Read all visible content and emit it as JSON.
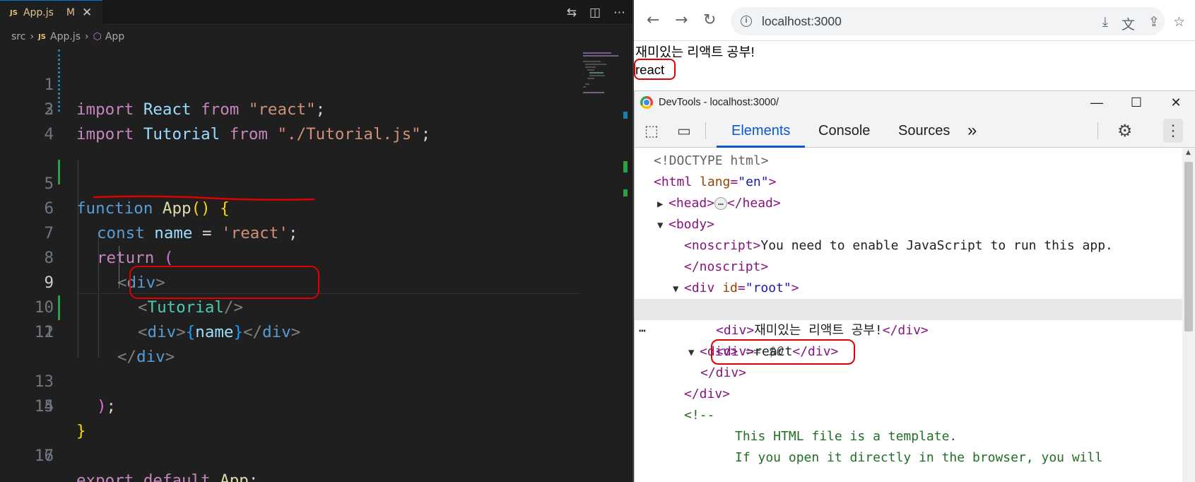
{
  "vscode": {
    "tab": {
      "file": "App.js",
      "lang_badge": "JS",
      "status": "M",
      "close": "✕"
    },
    "breadcrumb": {
      "folder": "src",
      "file": "App.js",
      "symbol": "App",
      "lang_badge": "JS"
    },
    "line_numbers": [
      "1",
      "2",
      "3",
      "4",
      "5",
      "6",
      "7",
      "8",
      "9",
      "10",
      "11",
      "12",
      "13",
      "14",
      "15",
      "16",
      "17"
    ],
    "code": {
      "l1": {
        "kw": "import",
        "name": "React",
        "from": "from",
        "src": "\"react\"",
        "end": ";"
      },
      "l2": {
        "kw": "import",
        "name": "Tutorial",
        "from": "from",
        "src": "\"./Tutorial.js\"",
        "end": ";"
      },
      "l5": {
        "kw": "function",
        "name": "App",
        "parens": "()",
        "brace": "{"
      },
      "l6": {
        "kw": "const",
        "name": "name",
        "eq": "=",
        "val": "'react'",
        "end": ";"
      },
      "l7": {
        "kw": "return",
        "paren": "("
      },
      "l8": {
        "open": "<",
        "tag": "div",
        "close": ">"
      },
      "l9": {
        "open": "<",
        "tag": "Tutorial",
        "close": "/>"
      },
      "l10": {
        "open": "<",
        "tag": "div",
        "close": ">",
        "b1": "{",
        "expr": "name",
        "b2": "}",
        "open2": "</",
        "tag2": "div",
        "close2": ">"
      },
      "l11": {
        "open": "</",
        "tag": "div",
        "close": ">"
      },
      "l13": {
        "paren": ")",
        "end": ";"
      },
      "l14": {
        "brace": "}"
      },
      "l16": {
        "kw1": "export",
        "kw2": "default",
        "name": "App",
        "end": ";"
      }
    }
  },
  "browser": {
    "url": "localhost:3000",
    "page_lines": [
      "재미있는 리액트 공부!",
      "react"
    ]
  },
  "devtools": {
    "title": "DevTools - localhost:3000/",
    "tabs": [
      "Elements",
      "Console",
      "Sources"
    ],
    "active_tab": "Elements",
    "more_tabs": "»",
    "tree": {
      "doctype": "<!DOCTYPE html>",
      "html_open": "<html",
      "html_attr": "lang",
      "html_val": "\"en\"",
      "head_open": "<head>",
      "head_ellipsis": "…",
      "head_close": "</head>",
      "body_open": "<body>",
      "noscript_open": "<noscript>",
      "noscript_text": "You need to enable JavaScript to run this app.",
      "noscript_close": "</noscript>",
      "root_open": "<div",
      "root_attr": "id",
      "root_val": "\"root\"",
      "div_open": "<div>",
      "selected_marker": "== $0",
      "child1_text": "재미있는 리액트 공부!",
      "child2_text": "react",
      "div_close": "</div>",
      "comment_open": "<!--",
      "comment_line1": "This HTML file is a template.",
      "comment_line2": "If you open it directly in the browser, you will"
    }
  },
  "colors": {
    "vscode_bg": "#1f1f1f",
    "annotation_red": "#e00000",
    "devtools_accent": "#0b57d0"
  }
}
